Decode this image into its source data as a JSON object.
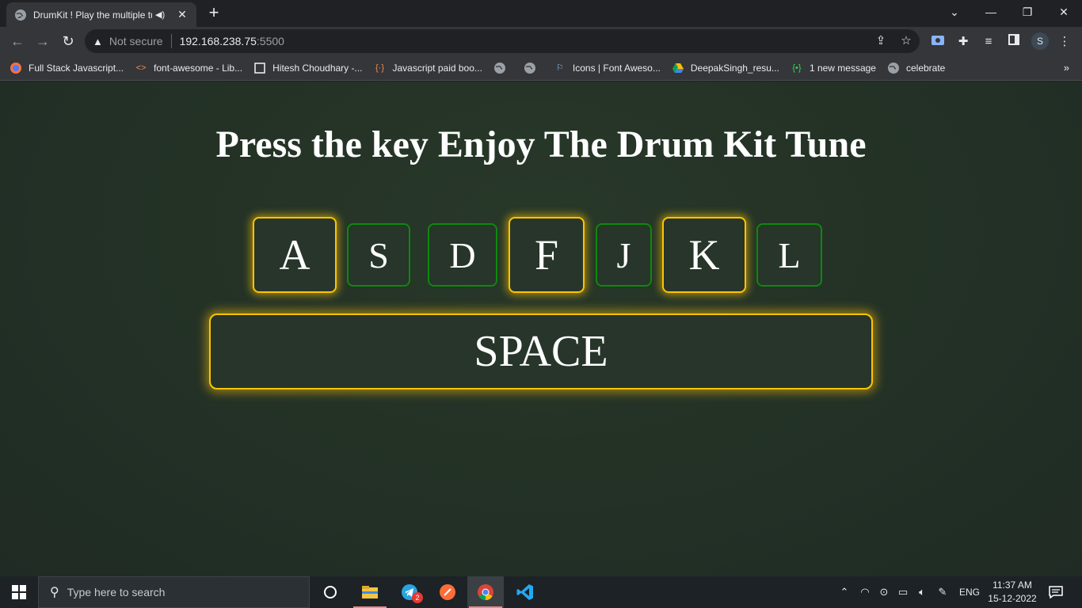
{
  "browser": {
    "tab": {
      "title": "DrumKit ! Play the multiple tunes",
      "audio_icon": "speaker-icon",
      "close_label": "✕"
    },
    "new_tab_label": "+",
    "window": {
      "minimize": "—",
      "restore": "❐",
      "close": "✕",
      "tab_search": "⌄"
    },
    "address": {
      "security_text": "Not secure",
      "host": "192.168.238.75",
      "port": ":5500"
    },
    "profile_initial": "S",
    "bookmarks": [
      {
        "label": "Full Stack Javascript...",
        "icon": "firefox-icon"
      },
      {
        "label": "font-awesome - Lib...",
        "icon": "code-icon"
      },
      {
        "label": "Hitesh Choudhary -...",
        "icon": "page-icon"
      },
      {
        "label": "Javascript paid boo...",
        "icon": "bracket-icon"
      },
      {
        "label": "",
        "icon": "globe-icon"
      },
      {
        "label": "",
        "icon": "globe-icon"
      },
      {
        "label": "Icons | Font Aweso...",
        "icon": "flag-icon"
      },
      {
        "label": "DeepakSingh_resu...",
        "icon": "drive-icon"
      },
      {
        "label": "1 new message",
        "icon": "chat-icon"
      },
      {
        "label": "celebrate",
        "icon": "globe-icon"
      }
    ],
    "bookmarks_more": "»"
  },
  "page": {
    "heading": "Press the key Enjoy The Drum Kit Tune",
    "keys": [
      {
        "label": "A",
        "active": true
      },
      {
        "label": "S",
        "active": false
      },
      {
        "label": "D",
        "active": false
      },
      {
        "label": "F",
        "active": true
      },
      {
        "label": "J",
        "active": false
      },
      {
        "label": "K",
        "active": true
      },
      {
        "label": "L",
        "active": false
      }
    ],
    "space_label": "SPACE",
    "colors": {
      "active_border": "#ffc400",
      "inactive_border": "#0c8a0c",
      "background": "#243226"
    }
  },
  "taskbar": {
    "search_placeholder": "Type here to search",
    "telegram_badge": "2",
    "language": "ENG",
    "time": "11:37 AM",
    "date": "15-12-2022"
  }
}
